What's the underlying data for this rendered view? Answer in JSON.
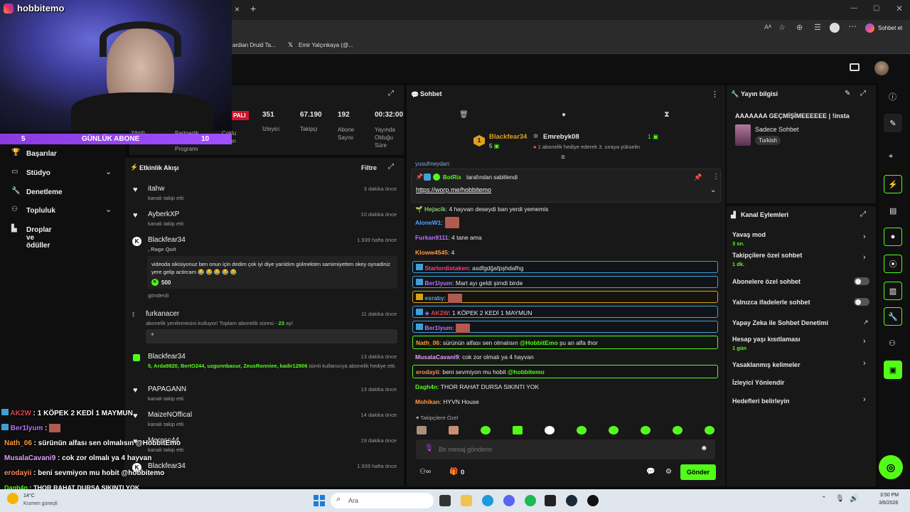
{
  "browser": {
    "tab_close": "×",
    "tab_new": "+",
    "bookmarks": [
      "ardian Druid Ta...",
      "Emir Yalçınkaya (@..."
    ],
    "copilot_label": "Sohbet et"
  },
  "webcam": {
    "instagram_handle": "hobbitemo"
  },
  "sub_goal": {
    "left_count": "5",
    "label": "GÜNLÜK ABONE",
    "right_count": "10"
  },
  "left_nav": {
    "partial_top": [
      "Yayın",
      "Partnerlik Gelir Programı",
      "Çoklu Yayın"
    ],
    "items": [
      {
        "label": "Başarılar"
      },
      {
        "label": "Stüdyo"
      },
      {
        "label": "Denetleme"
      },
      {
        "label": "Topluluk"
      },
      {
        "label": "Droplar ve ödüller"
      }
    ]
  },
  "stats": {
    "live_badge": "PALI",
    "items": [
      {
        "value": "351",
        "label": "İzleyici"
      },
      {
        "value": "67.190",
        "label": "Takipçi"
      },
      {
        "value": "192",
        "label": "Abone Sayısı"
      },
      {
        "value": "00:32:00",
        "label": "Yayında Olduğu Süre"
      }
    ]
  },
  "activity": {
    "title": "Etkinlik Akışı",
    "filter_label": "Filtre",
    "events": [
      {
        "name": "itahw",
        "sub": "kanalı takip etti",
        "time": "3 dakika önce"
      },
      {
        "name": "AyberkXP",
        "sub": "kanalı takip etti",
        "time": "10 dakika önce"
      },
      {
        "name": "Blackfear34",
        "sub": ", Rage Quit",
        "time": "1.939 hafta önce",
        "message": "videoda sikisiyonuz ben onun için dedim çok iyi diye yarıldım gülmekten samimiyetten okey oynadiniz yere gelip actircam 😂 😂 😂 😂 😂",
        "amount": "500",
        "footer": "gönderdi"
      },
      {
        "name": "furkanacer",
        "sub": "abonelik yenilemesini kutluyor! Toplam abonelik süresi - ",
        "sub_count": "23",
        "sub_tail": " ay!",
        "time": "11 dakika önce"
      },
      {
        "name": "Blackfear34",
        "sub": "5, Arda9820, BertO244, uzgunnbasur, ZeusRonniee, kadir12906",
        "sub_tail": " isimli kullanıcıya abonelik hediye etti.",
        "time": "13 dakika önce"
      },
      {
        "name": "PAPAGANN",
        "sub": "kanalı takip etti",
        "time": "13 dakika önce"
      },
      {
        "name": "MaizeNOffical",
        "sub": "kanalı takip etti",
        "time": "14 dakika önce"
      },
      {
        "name": "Meross44",
        "sub": "kanalı takip etti",
        "time": "19 dakika önce"
      },
      {
        "name": "Blackfear34",
        "sub": "it",
        "time": "1.939 hafta önce"
      }
    ]
  },
  "chat": {
    "title": "Sohbet",
    "top_gifter": {
      "rank": "1",
      "name": "Blackfear34",
      "count": "5"
    },
    "second": {
      "name": "Emrebyk08",
      "count": "1",
      "note": "1 abonelik hediye ederek 3. sıraya yükselin"
    },
    "partial_user": "yusufmeydan:",
    "pinned": {
      "by": "BotRix",
      "label": "tarafından sabitlendi",
      "link": "https://worp.me/hobbitemo"
    },
    "messages": [
      {
        "user": "Hejacik",
        "color": "#7fd06a",
        "text": " 4 hayvan deseydi ban yerdi yememis"
      },
      {
        "user": "AloneW1",
        "color": "#52a0ff",
        "text": ""
      },
      {
        "user": "Furkan9111",
        "color": "#c070ff",
        "text": " 4 tane ama"
      },
      {
        "user": "Kloww4545",
        "color": "#ff9a3c",
        "text": " 4"
      },
      {
        "user": "Starlordistaken",
        "color": "#ff4080",
        "text": " asdfgdğafpşhdafhg"
      },
      {
        "user": "Ber1lyum",
        "color": "#c070ff",
        "text": " Mart ayı geldi şimdi birde"
      },
      {
        "user": "esraby",
        "color": "#52a0ff",
        "text": ""
      },
      {
        "user": "AK2W",
        "color": "#e04050",
        "text": " 1 KÖPEK 2 KEDİ 1 MAYMUN"
      },
      {
        "user": "Ber1lyum",
        "color": "#c070ff",
        "text": ""
      },
      {
        "user": "Nath_06",
        "color": "#ff9a3c",
        "text": " sürünün alfası sen olmalısın ",
        "mention": "@HobbitEmo",
        "tail": " şu an alfa thor"
      },
      {
        "user": "MusalaCavani9",
        "color": "#e0a0ff",
        "text": " cok zor olmalı ya 4 hayvan"
      },
      {
        "user": "erodayii",
        "color": "#ff8a5c",
        "text": " beni sevmiyon mu hobit ",
        "mention": "@hobbitemo"
      },
      {
        "user": "Dagh4n",
        "color": "#53fc18",
        "text": " THOR RAHAT DURSA SIKINTI YOK"
      },
      {
        "user": "Mohikan",
        "color": "#ff9a3c",
        "text": " HYVN House"
      }
    ],
    "followers_only": "Takipçilere Özel",
    "input_placeholder": "Bir mesaj gönderin",
    "points": "0",
    "send_label": "Gönder"
  },
  "stream_info": {
    "title": "Yayın bilgisi",
    "stream_title": "AAAAAAA GEÇMİŞİMEEEEEE | !insta",
    "category": "Sadece Sohbet",
    "language": "Turkish"
  },
  "channel_actions": {
    "title": "Kanal Eylemleri",
    "items": [
      {
        "label": "Yavaş mod",
        "sub": "3 sn.",
        "control": "chevron"
      },
      {
        "label": "Takipçilere özel sohbet",
        "sub": "1 dk.",
        "control": "chevron"
      },
      {
        "label": "Abonelere özel sohbet",
        "sub": "",
        "control": "toggle"
      },
      {
        "label": "Yalnızca ifadelerle sohbet",
        "sub": "",
        "control": "toggle"
      },
      {
        "label": "Yapay Zeka ile Sohbet Denetimi",
        "sub": "",
        "control": "external"
      },
      {
        "label": "Hesap yaşı kısıtlaması",
        "sub": "1 gün",
        "control": "chevron"
      },
      {
        "label": "Yasaklanmış kelimeler",
        "sub": "",
        "control": "chevron"
      },
      {
        "label": "İzleyici Yönlendir",
        "sub": "",
        "control": "none"
      },
      {
        "label": "Hedefleri belirleyin",
        "sub": "",
        "control": "chevron"
      }
    ]
  },
  "overlay_chat": [
    {
      "user": "AK2W",
      "color": "#e04050",
      "text": " : 1 KÖPEK 2 KEDİ 1 MAYMUN"
    },
    {
      "user": "Ber1lyum",
      "color": "#c070ff",
      "text": " :"
    },
    {
      "user": "Nath_06",
      "color": "#ff9a3c",
      "text": " : sürünün alfası sen olmalısın @HobbitEmo"
    },
    {
      "user": "MusalaCavani9",
      "color": "#e0a0ff",
      "text": " : cok zor olmalı ya 4 hayvan"
    },
    {
      "user": "erodayii",
      "color": "#ff8a5c",
      "text": " : beni sevmiyon mu hobit @hobbitemo"
    },
    {
      "user": "Dagh4n",
      "color": "#53fc18",
      "text": " : THOR RAHAT DURSA SIKINTI YOK"
    }
  ],
  "taskbar": {
    "weather_temp": "14°C",
    "weather_desc": "Kısmen güneşli",
    "search_placeholder": "Ara",
    "time": "3:50 PM",
    "date": "3/6/2026"
  },
  "colors": {
    "accent": "#53fc18",
    "panel": "#181818",
    "bg": "#0b0b0b"
  }
}
